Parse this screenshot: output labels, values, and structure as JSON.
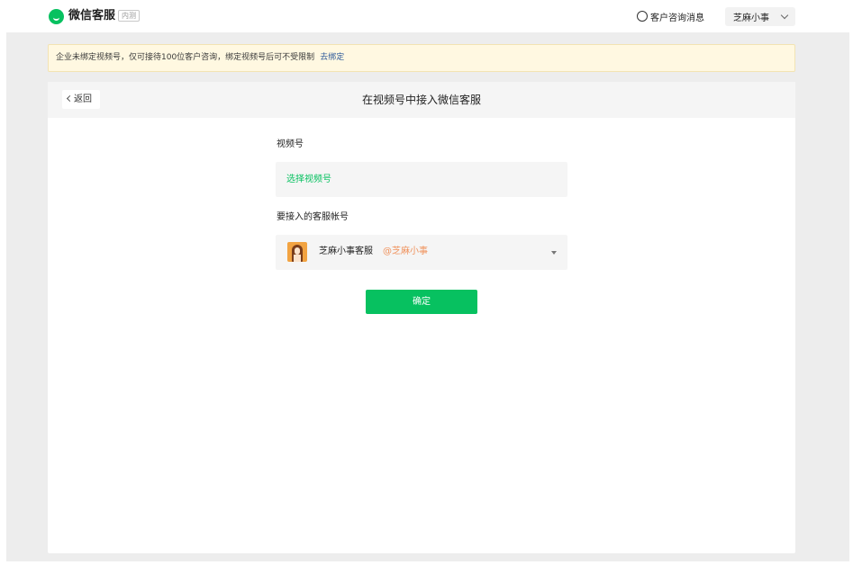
{
  "header": {
    "app_title": "微信客服",
    "beta_badge": "内测",
    "messages_link": "客户咨询消息",
    "user_name": "芝麻小事"
  },
  "notice": {
    "text": "企业未绑定视频号，仅可接待100位客户咨询，绑定视频号后可不受限制",
    "link": "去绑定"
  },
  "panel": {
    "back_label": "返回",
    "title": "在视频号中接入微信客服",
    "channel_label": "视频号",
    "channel_placeholder": "选择视频号",
    "account_label": "要接入的客服帐号",
    "account_name": "芝麻小事客服",
    "account_handle": "@芝麻小事",
    "confirm_label": "确定"
  },
  "colors": {
    "accent": "#07c160",
    "link": "#2e5a9a",
    "handle": "#f0925c",
    "notice_bg": "#fff8e1"
  },
  "icons": [
    "wechat-service-logo-icon",
    "chat-bubble-icon",
    "chevron-down-icon",
    "chevron-left-icon",
    "dropdown-caret-icon"
  ]
}
